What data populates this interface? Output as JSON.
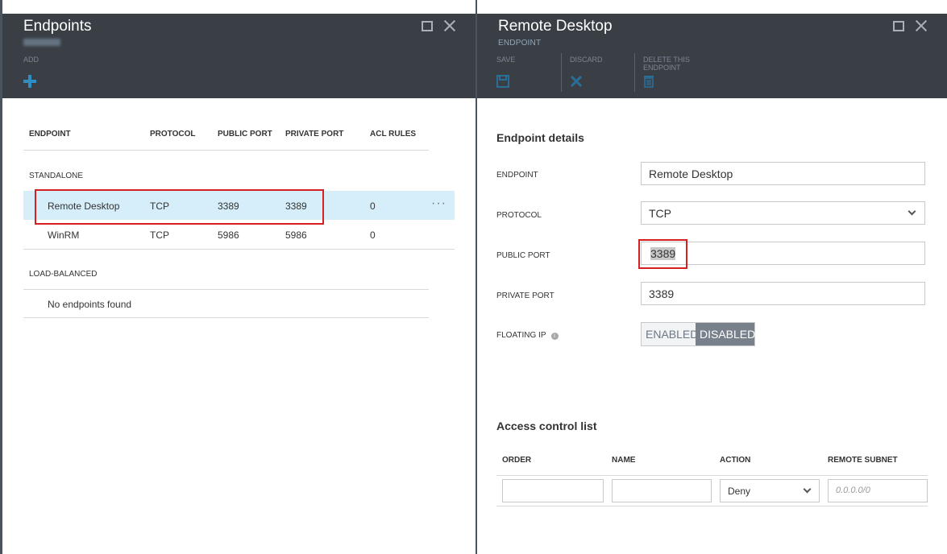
{
  "left_blade": {
    "title": "Endpoints",
    "commands": {
      "add_label": "ADD"
    },
    "table": {
      "columns": [
        "ENDPOINT",
        "PROTOCOL",
        "PUBLIC PORT",
        "PRIVATE PORT",
        "ACL RULES"
      ],
      "standalone_label": "STANDALONE",
      "rows": [
        {
          "endpoint": "Remote Desktop",
          "protocol": "TCP",
          "public_port": "3389",
          "private_port": "3389",
          "acl_rules": "0",
          "more": "···"
        },
        {
          "endpoint": "WinRM",
          "protocol": "TCP",
          "public_port": "5986",
          "private_port": "5986",
          "acl_rules": "0"
        }
      ],
      "load_balanced_label": "LOAD-BALANCED",
      "empty_message": "No endpoints found"
    }
  },
  "right_blade": {
    "title": "Remote Desktop",
    "subtitle": "ENDPOINT",
    "commands": {
      "save_label": "SAVE",
      "discard_label": "DISCARD",
      "delete_line1": "DELETE THIS",
      "delete_line2": "ENDPOINT"
    },
    "details": {
      "section_title": "Endpoint details",
      "endpoint_label": "ENDPOINT",
      "endpoint_value": "Remote Desktop",
      "protocol_label": "PROTOCOL",
      "protocol_value": "TCP",
      "public_port_label": "PUBLIC PORT",
      "public_port_value": "3389",
      "private_port_label": "PRIVATE PORT",
      "private_port_value": "3389",
      "floating_ip_label": "FLOATING IP",
      "floating_ip_info": "i",
      "floating_ip_options": [
        "ENABLED",
        "DISABLED"
      ],
      "floating_ip_selected": "DISABLED"
    },
    "acl": {
      "section_title": "Access control list",
      "columns": [
        "ORDER",
        "NAME",
        "ACTION",
        "REMOTE SUBNET"
      ],
      "action_value": "Deny",
      "subnet_placeholder": "0.0.0.0/0"
    }
  },
  "colors": {
    "header_bg": "#3a3f46",
    "accent": "#2f8fc5",
    "selected_row": "#d5eef9",
    "highlight_border": "#d42020",
    "toggle_on": "#77808b"
  }
}
